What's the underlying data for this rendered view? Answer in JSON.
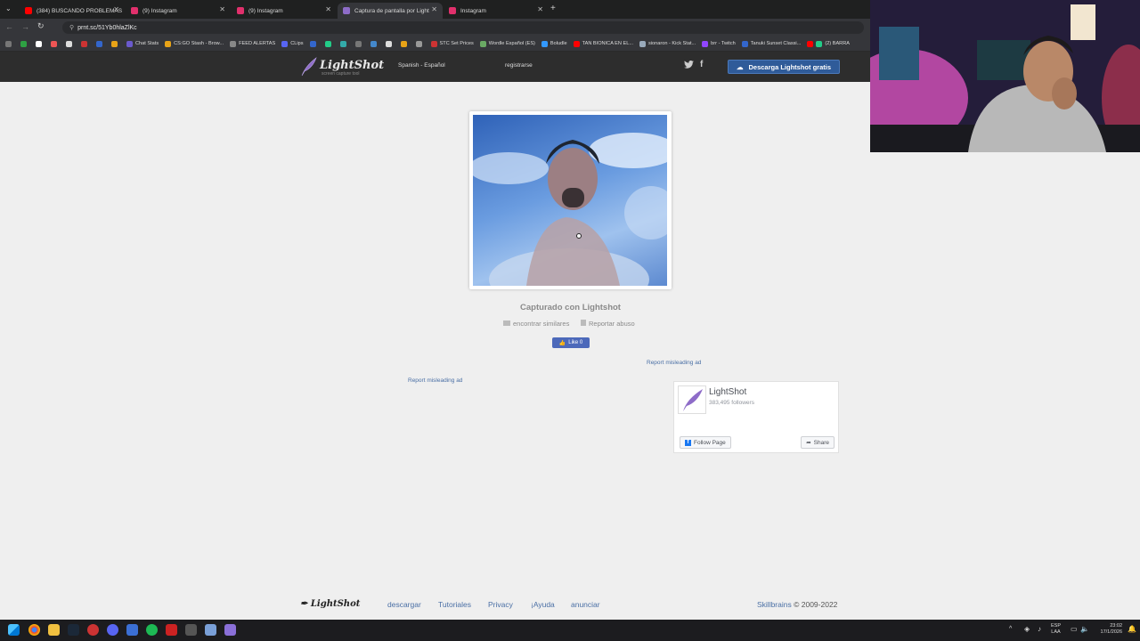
{
  "browser": {
    "tabs": [
      {
        "title": "(384) BUSCANDO PROBLEMAS",
        "color": "#ff0000"
      },
      {
        "title": "(9) Instagram",
        "color": "#e1306c"
      },
      {
        "title": "(9) Instagram",
        "color": "#e1306c"
      },
      {
        "title": "Captura de pantalla por LightShot",
        "color": "#8e6cc8"
      },
      {
        "title": "Instagram",
        "color": "#e1306c"
      }
    ],
    "new_tab": "+",
    "url": "prnt.sc/51Yb0hlaZlKc",
    "bookmarks": [
      "Chat Stats",
      "CS:GO Stash - Brow...",
      "FEED ALERTAS",
      "CLips",
      "STC Set Prices",
      "Wordle Español (ES)",
      "Boludle",
      "TAN BIONICA EN EL...",
      "sionaron - Kick Stat...",
      "brr - Twitch",
      "Tanuki Sunset Classi...",
      "(2) BARRA"
    ]
  },
  "header": {
    "logo_name": "LightShot",
    "logo_tagline": "screen capture tool",
    "language": "Spanish - Español",
    "register": "registrarse",
    "twitter_glyph": "🐦",
    "facebook_glyph": "f",
    "download_button": "Descarga Lightshot gratis"
  },
  "main": {
    "caption": "Capturado con Lightshot",
    "find_similar": "encontrar similares",
    "report_abuse": "Reportar abuso",
    "like_button": "Like 0",
    "ad_report_1": "Report misleading ad",
    "ad_report_2": "Report misleading ad"
  },
  "fb_widget": {
    "page_name": "LightShot",
    "followers": "383,495 followers",
    "follow_button": "Follow Page",
    "share_button": "Share"
  },
  "footer": {
    "logo": "LightShot",
    "links": [
      "descargar",
      "Tutoriales",
      "Privacy",
      "¡Ayuda",
      "anunciar"
    ],
    "brand": "Skillbrains",
    "copyright": "© 2009-2022"
  },
  "taskbar": {
    "lang_top": "ESP",
    "lang_bottom": "LAA",
    "time": "23:02",
    "date": "17/1/2026"
  }
}
